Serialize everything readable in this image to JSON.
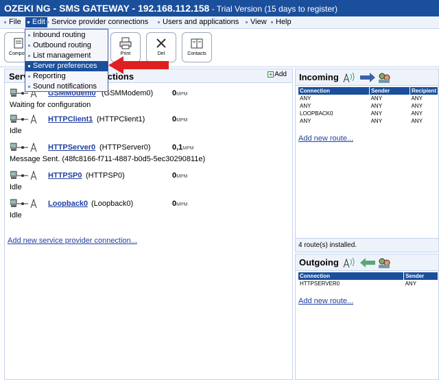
{
  "titlebar": {
    "main": "OZEKI NG - SMS GATEWAY - 192.168.112.158",
    "sub": " - Trial Version (15 days to register)"
  },
  "menubar": {
    "file": "File",
    "edit": "Edit",
    "service_provider": "Service provider connections",
    "users": "Users and applications",
    "view": "View",
    "help": "Help"
  },
  "dropdown": {
    "items": [
      "Inbound routing",
      "Outbound routing",
      "List management",
      "Server preferences",
      "Reporting",
      "Sound notifications"
    ]
  },
  "toolbar": {
    "compose": "Compose",
    "print": "Print",
    "del": "Del",
    "contacts": "Contacts"
  },
  "left_panel": {
    "title": "Service provider connections",
    "add_label": "Add",
    "connections": [
      {
        "name": "GSMModem0",
        "type": "(GSMModem0)",
        "rate": "0",
        "unit": "MPM",
        "status": "Waiting for configuration"
      },
      {
        "name": "HTTPClient1",
        "type": "(HTTPClient1)",
        "rate": "0",
        "unit": "MPM",
        "status": "Idle"
      },
      {
        "name": "HTTPServer0",
        "type": "(HTTPServer0)",
        "rate": "0,1",
        "unit": "MPM",
        "status": "Message Sent. (48fc8166-f711-4887-b0d5-5ec30290811e)"
      },
      {
        "name": "HTTPSP0",
        "type": "(HTTPSP0)",
        "rate": "0",
        "unit": "MPM",
        "status": "Idle"
      },
      {
        "name": "Loopback0",
        "type": "(Loopback0)",
        "rate": "0",
        "unit": "MPM",
        "status": "Idle"
      }
    ],
    "add_link": "Add new service provider connection..."
  },
  "incoming": {
    "title": "Incoming",
    "columns": [
      "Connection",
      "Sender",
      "Recipient"
    ],
    "rows": [
      [
        "ANY",
        "ANY",
        "ANY"
      ],
      [
        "ANY",
        "ANY",
        "ANY"
      ],
      [
        "LOOPBACK0",
        "ANY",
        "ANY"
      ],
      [
        "ANY",
        "ANY",
        "ANY"
      ]
    ],
    "add_link": "Add new route...",
    "footer": "4 route(s) installed."
  },
  "outgoing": {
    "title": "Outgoing",
    "columns": [
      "Connection",
      "Sender"
    ],
    "rows": [
      [
        "HTTPSERVER0",
        "ANY"
      ]
    ],
    "add_link": "Add new route..."
  },
  "colors": {
    "title_bg": "#1a4f9c",
    "menu_bg": "#eef3fb",
    "highlight": "#1a4f9c",
    "arrow": "#e02020"
  }
}
